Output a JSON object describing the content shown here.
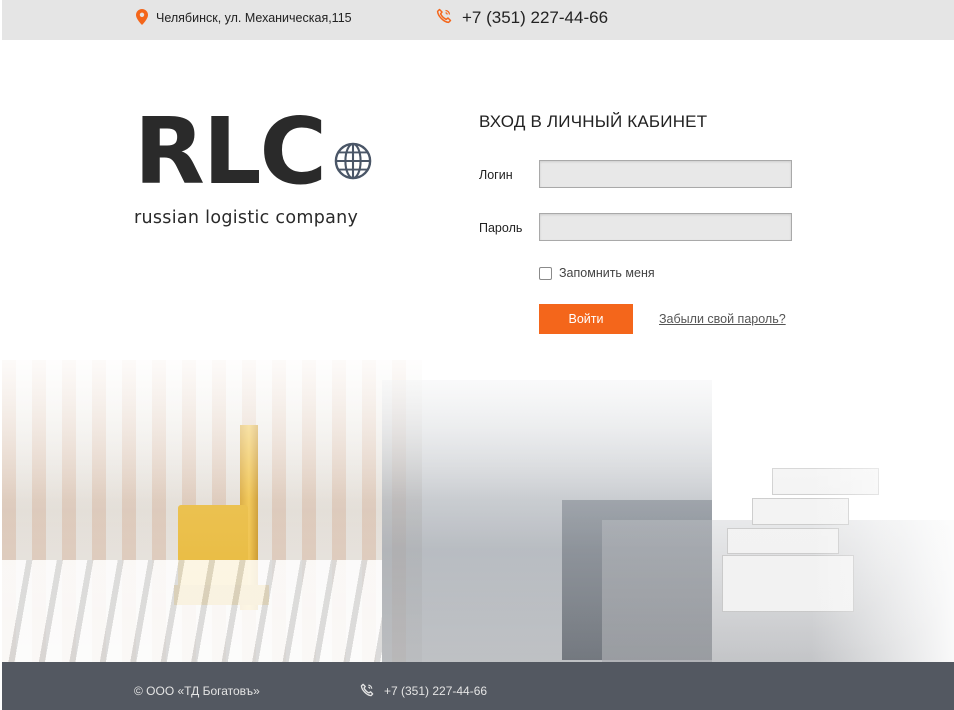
{
  "header": {
    "address": "Челябинск, ул. Механическая,115",
    "address_icon": "map-pin-icon",
    "phone": "+7 (351) 227-44-66",
    "phone_icon": "phone-icon",
    "accent_color": "#f4661b"
  },
  "logo": {
    "letters": "RLC",
    "tagline": "russian logistic company"
  },
  "login": {
    "title": "ВХОД В ЛИЧНЫЙ КАБИНЕТ",
    "login_label": "Логин",
    "login_value": "",
    "password_label": "Пароль",
    "password_value": "",
    "remember_label": "Запомнить меня",
    "remember_checked": false,
    "submit_label": "Войти",
    "forgot_label": "Забыли свой пароль?",
    "button_color": "#f4661b"
  },
  "footer": {
    "copyright": "© ООО «ТД Богатовъ»",
    "phone": "+7 (351) 227-44-66",
    "phone_icon": "phone-icon",
    "background": "#535861"
  }
}
